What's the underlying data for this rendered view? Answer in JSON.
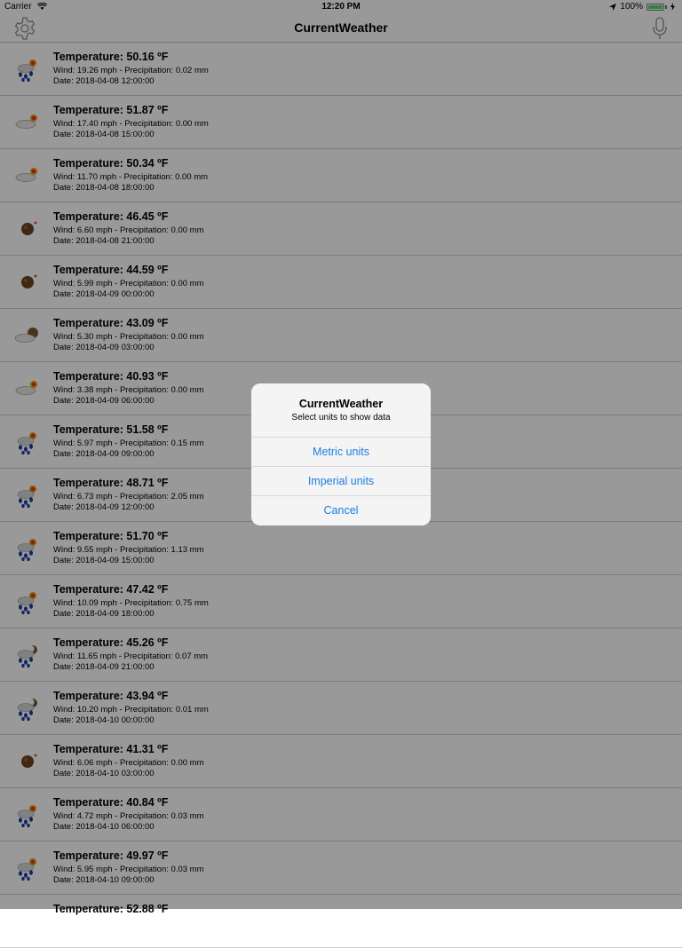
{
  "status_bar": {
    "carrier": "Carrier",
    "time": "12:20 PM",
    "battery_text": "100%",
    "battery_level": 1.0
  },
  "navbar": {
    "title": "CurrentWeather"
  },
  "colors": {
    "accent": "#1a7ee0",
    "overlay": "rgba(0,0,0,0.40)"
  },
  "forecasts": [
    {
      "title": "Temperature: 50.16 ºF",
      "details": "Wind: 19.26  mph - Precipitation: 0.02 mm",
      "date": "Date: 2018-04-08 12:00:00",
      "icon": "rain-sun-icon"
    },
    {
      "title": "Temperature: 51.87 ºF",
      "details": "Wind: 17.40  mph - Precipitation: 0.00 mm",
      "date": "Date: 2018-04-08 15:00:00",
      "icon": "cloud-sun-icon"
    },
    {
      "title": "Temperature: 50.34 ºF",
      "details": "Wind: 11.70  mph - Precipitation: 0.00 mm",
      "date": "Date: 2018-04-08 18:00:00",
      "icon": "cloud-sun-icon"
    },
    {
      "title": "Temperature: 46.45 ºF",
      "details": "Wind: 6.60  mph - Precipitation: 0.00 mm",
      "date": "Date: 2018-04-08 21:00:00",
      "icon": "moon-icon"
    },
    {
      "title": "Temperature: 44.59 ºF",
      "details": "Wind: 5.99  mph - Precipitation: 0.00 mm",
      "date": "Date: 2018-04-09 00:00:00",
      "icon": "moon-icon"
    },
    {
      "title": "Temperature: 43.09 ºF",
      "details": "Wind: 5.30  mph - Precipitation: 0.00 mm",
      "date": "Date: 2018-04-09 03:00:00",
      "icon": "cloud-moon-icon"
    },
    {
      "title": "Temperature: 40.93 ºF",
      "details": "Wind: 3.38  mph - Precipitation: 0.00 mm",
      "date": "Date: 2018-04-09 06:00:00",
      "icon": "cloud-sun-icon"
    },
    {
      "title": "Temperature: 51.58 ºF",
      "details": "Wind: 5.97  mph - Precipitation: 0.15 mm",
      "date": "Date: 2018-04-09 09:00:00",
      "icon": "rain-sun-icon"
    },
    {
      "title": "Temperature: 48.71 ºF",
      "details": "Wind: 6.73  mph - Precipitation: 2.05 mm",
      "date": "Date: 2018-04-09 12:00:00",
      "icon": "rain-sun-icon"
    },
    {
      "title": "Temperature: 51.70 ºF",
      "details": "Wind: 9.55  mph - Precipitation: 1.13 mm",
      "date": "Date: 2018-04-09 15:00:00",
      "icon": "rain-sun-icon"
    },
    {
      "title": "Temperature: 47.42 ºF",
      "details": "Wind: 10.09  mph - Precipitation: 0.75 mm",
      "date": "Date: 2018-04-09 18:00:00",
      "icon": "rain-sun-icon"
    },
    {
      "title": "Temperature: 45.26 ºF",
      "details": "Wind: 11.65  mph - Precipitation: 0.07 mm",
      "date": "Date: 2018-04-09 21:00:00",
      "icon": "rain-moon-icon"
    },
    {
      "title": "Temperature: 43.94 ºF",
      "details": "Wind: 10.20  mph - Precipitation: 0.01 mm",
      "date": "Date: 2018-04-10 00:00:00",
      "icon": "rain-moon-icon"
    },
    {
      "title": "Temperature: 41.31 ºF",
      "details": "Wind: 6.06  mph - Precipitation: 0.00 mm",
      "date": "Date: 2018-04-10 03:00:00",
      "icon": "moon-icon"
    },
    {
      "title": "Temperature: 40.84 ºF",
      "details": "Wind: 4.72  mph - Precipitation: 0.03 mm",
      "date": "Date: 2018-04-10 06:00:00",
      "icon": "rain-sun-icon"
    },
    {
      "title": "Temperature: 49.97 ºF",
      "details": "Wind: 5.95  mph - Precipitation: 0.03 mm",
      "date": "Date: 2018-04-10 09:00:00",
      "icon": "rain-sun-icon"
    },
    {
      "title": "Temperature: 52.88 ºF",
      "details": "",
      "date": "",
      "icon": ""
    }
  ],
  "alert": {
    "title": "CurrentWeather",
    "message": "Select units to show data",
    "metric_label": "Metric units",
    "imperial_label": "Imperial units",
    "cancel_label": "Cancel"
  }
}
